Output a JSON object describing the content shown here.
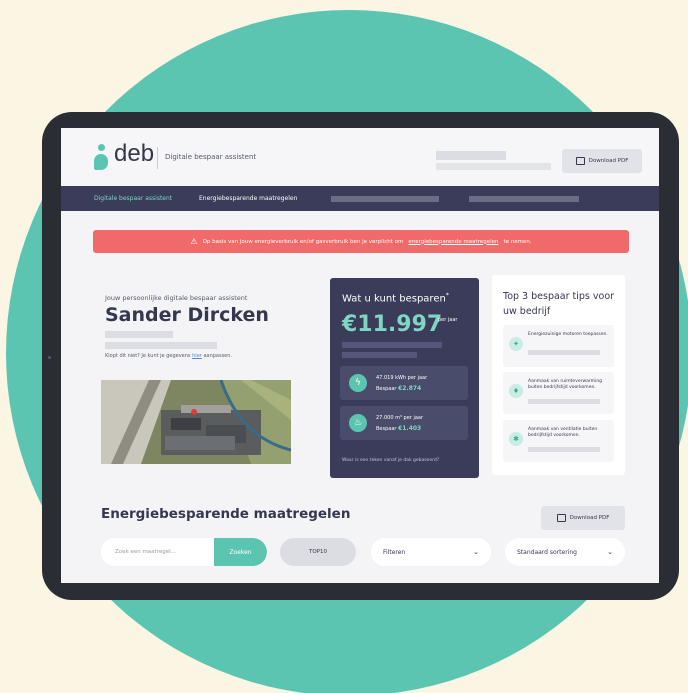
{
  "app": {
    "logo_text": "deb",
    "tagline": "Digitale bespaar assistent",
    "download_pdf_label": "Download PDF"
  },
  "nav": {
    "item_active": "Digitale bespaar assistent",
    "item_2": "Energiebesparende maatregelen"
  },
  "alert": {
    "text": "Op basis van jouw energieverbruik en/of gasverbruik ben je verplicht om",
    "link": "energiebesparende maatregelen",
    "suffix": "te nemen."
  },
  "profile": {
    "subtitle": "Jouw persoonlijke digitale bespaar assistent",
    "name": "Sander Dircken",
    "fix_text": "Klopt dit niet? Je kunt je gegevens",
    "fix_link": "hier",
    "fix_suffix": "aanpassen."
  },
  "savings": {
    "title": "Wat u kunt besparen",
    "title_mark": "*",
    "amount": "€11.997",
    "per_year": "per jaar",
    "items": [
      {
        "icon": "lightning-icon",
        "line1": "47.019 kWh per jaar",
        "line2_prefix": "Bespaar",
        "value": "€2.874"
      },
      {
        "icon": "flame-icon",
        "line1": "27.000 m³ per jaar",
        "line2_prefix": "Bespaar",
        "value": "€1.403"
      }
    ],
    "footnote": "Waar is een teken vanaf je dak gebaseerd?"
  },
  "tips": {
    "title": "Top 3 bespaar tips voor uw bedrijf",
    "items": [
      {
        "icon": "lightbulb-icon",
        "text": "Energiezuinige motoren toepassen."
      },
      {
        "icon": "thermostat-icon",
        "text": "Aanmaak van ruimteverwarming buiten bedrijfstijd voorkomen."
      },
      {
        "icon": "fan-icon",
        "text": "Aanmaak van ventilatie buiten bedrijfstijd voorkomen."
      }
    ]
  },
  "measures": {
    "title": "Energiebesparende maatregelen",
    "search_placeholder": "Zoek een maatregel...",
    "search_button": "Zoeken",
    "top10_label": "TOP10",
    "filter_label": "Filteren",
    "sort_label": "Standaard sortering"
  },
  "colors": {
    "accent": "#5cc5b1",
    "navy": "#3a3c59",
    "alert": "#f06a6a",
    "background": "#fbf5e3"
  }
}
